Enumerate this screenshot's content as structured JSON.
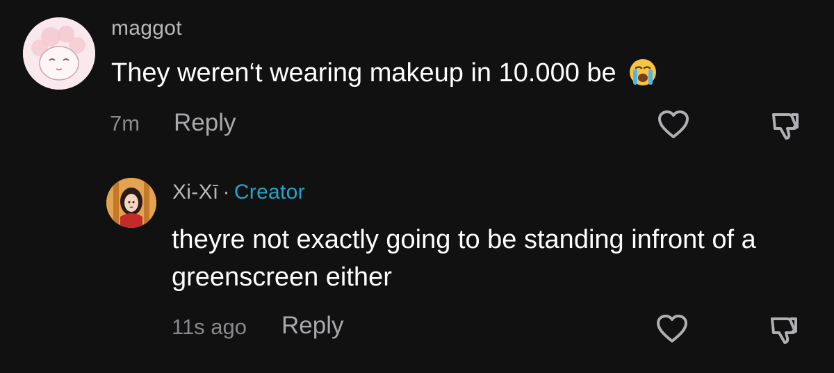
{
  "comments": [
    {
      "username": "maggot",
      "text": "They weren‘t wearing makeup in 10.000 be",
      "emoji_icon": "loudly-crying-face-emoji",
      "timestamp": "7m",
      "reply_label": "Reply"
    },
    {
      "username": "Xi-Xī",
      "separator": "·",
      "badge": "Creator",
      "text": "theyre not exactly going to be standing infront of a greenscreen either",
      "timestamp": "11s ago",
      "reply_label": "Reply"
    }
  ],
  "colors": {
    "background": "#111111",
    "username": "#b9b9bd",
    "creator_badge": "#26a5c9",
    "text": "#ffffff",
    "meta": "#8a8a8e"
  },
  "icons": [
    "heart-outline-icon",
    "thumbs-down-outline-icon"
  ]
}
